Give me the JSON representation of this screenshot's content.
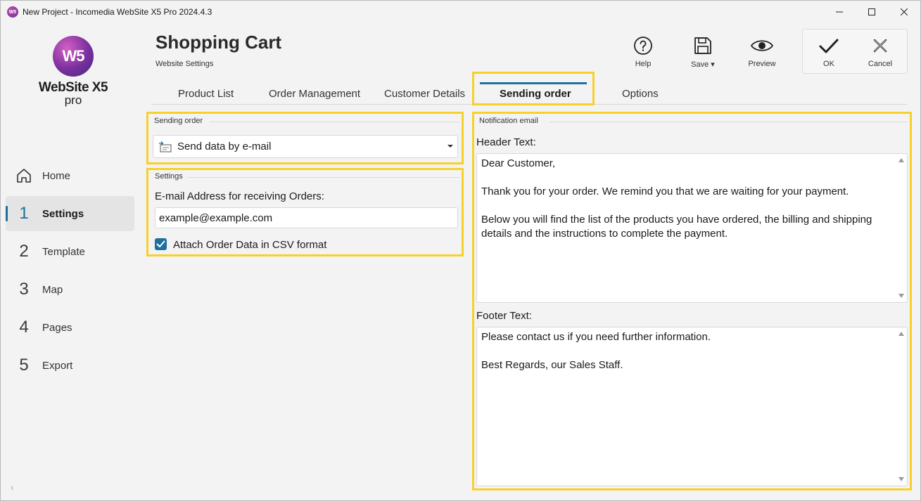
{
  "window": {
    "title": "New Project - Incomedia WebSite X5 Pro 2024.4.3",
    "app_icon": "W5"
  },
  "logo": {
    "mark": "W5",
    "name": "WebSite X5",
    "edition": "pro"
  },
  "sidebar": {
    "items": [
      {
        "number": "",
        "icon": "home-icon",
        "label": "Home"
      },
      {
        "number": "1",
        "label": "Settings",
        "active": true
      },
      {
        "number": "2",
        "label": "Template"
      },
      {
        "number": "3",
        "label": "Map"
      },
      {
        "number": "4",
        "label": "Pages"
      },
      {
        "number": "5",
        "label": "Export"
      }
    ],
    "collapse": "‹"
  },
  "header": {
    "title": "Shopping Cart",
    "subtitle": "Website Settings"
  },
  "toolbar": {
    "help": "Help",
    "save": "Save ▾",
    "preview": "Preview",
    "ok": "OK",
    "cancel": "Cancel"
  },
  "tabs": [
    {
      "label": "Product List"
    },
    {
      "label": "Order Management"
    },
    {
      "label": "Customer Details"
    },
    {
      "label": "Sending order",
      "active": true
    },
    {
      "label": "Options"
    }
  ],
  "sending_order": {
    "group_title": "Sending order",
    "selected": "Send data by e-mail"
  },
  "settings": {
    "group_title": "Settings",
    "email_label": "E-mail Address for receiving Orders:",
    "email_value": "example@example.com",
    "attach_label": "Attach Order Data in CSV format",
    "attach_checked": true
  },
  "notification": {
    "group_title": "Notification email",
    "header_label": "Header Text:",
    "header_lines": [
      "Dear Customer,",
      "",
      "Thank you for your order. We remind you that we are waiting for your payment.",
      "",
      "Below you will find the list of the products you have ordered, the billing and shipping details and the instructions to complete the payment."
    ],
    "footer_label": "Footer Text:",
    "footer_lines": [
      "Please contact us if you need further information.",
      "",
      "Best Regards, our Sales Staff."
    ]
  },
  "colors": {
    "accent": "#1d6f9e",
    "highlight": "#f7d02c"
  }
}
